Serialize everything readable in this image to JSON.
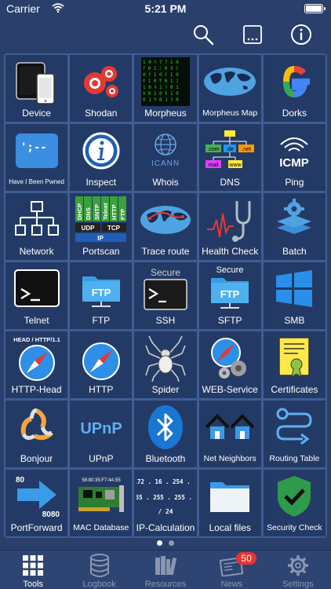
{
  "status": {
    "carrier": "Carrier",
    "time": "5:21 PM",
    "battery_level": 1.0
  },
  "toolbar": {
    "buttons": [
      {
        "icon": "search-icon"
      },
      {
        "icon": "ellipsis-icon"
      },
      {
        "icon": "info-icon"
      }
    ]
  },
  "tools": [
    {
      "label": "Device"
    },
    {
      "label": "Shodan"
    },
    {
      "label": "Morpheus"
    },
    {
      "label": "Morpheus Map"
    },
    {
      "label": "Dorks"
    },
    {
      "label": "Have I Been Pwned"
    },
    {
      "label": "Inspect"
    },
    {
      "label": "Whois",
      "icon_text": "ICANN"
    },
    {
      "label": "DNS",
      "icon_texts": [
        ".com",
        ".de",
        ".net",
        "mail",
        "www"
      ]
    },
    {
      "label": "Ping",
      "icon_text": "ICMP"
    },
    {
      "label": "Network"
    },
    {
      "label": "Portscan",
      "icon_texts": [
        "DHCP",
        "DNS",
        "SNTP",
        "Telnet",
        "HTTP",
        "FTP",
        "UDP",
        "TCP",
        "IP"
      ]
    },
    {
      "label": "Trace route"
    },
    {
      "label": "Health Check"
    },
    {
      "label": "Batch"
    },
    {
      "label": "Telnet"
    },
    {
      "label": "FTP",
      "icon_text": "FTP"
    },
    {
      "label": "SSH",
      "icon_text": "Secure"
    },
    {
      "label": "SFTP",
      "icon_texts": [
        "Secure",
        "FTP"
      ]
    },
    {
      "label": "SMB"
    },
    {
      "label": "HTTP-Head",
      "icon_text": "HEAD / HTTP/1.1"
    },
    {
      "label": "HTTP"
    },
    {
      "label": "Spider"
    },
    {
      "label": "WEB-Service"
    },
    {
      "label": "Certificates"
    },
    {
      "label": "Bonjour"
    },
    {
      "label": "UPnP",
      "icon_text": "UPnP"
    },
    {
      "label": "Bluetooth"
    },
    {
      "label": "Net Neighbors"
    },
    {
      "label": "Routing Table"
    },
    {
      "label": "PortForward",
      "icon_texts": [
        "80",
        "8080"
      ]
    },
    {
      "label": "MAC Database",
      "icon_text": "58:80:35:F7:4A:55"
    },
    {
      "label": "IP-Calculation",
      "icon_texts": [
        "172 . 16 . 254 . 1",
        "255 . 255 . 255 . 0",
        "/ 24"
      ]
    },
    {
      "label": "Local files"
    },
    {
      "label": "Security Check"
    }
  ],
  "pager": {
    "pages": 2,
    "current": 1
  },
  "tabs": [
    {
      "label": "Tools",
      "icon": "grid-icon",
      "active": true
    },
    {
      "label": "Logbook",
      "icon": "database-icon"
    },
    {
      "label": "Resources",
      "icon": "books-icon"
    },
    {
      "label": "News",
      "icon": "newspaper-icon",
      "badge": "50"
    },
    {
      "label": "Settings",
      "icon": "gear-icon"
    }
  ]
}
